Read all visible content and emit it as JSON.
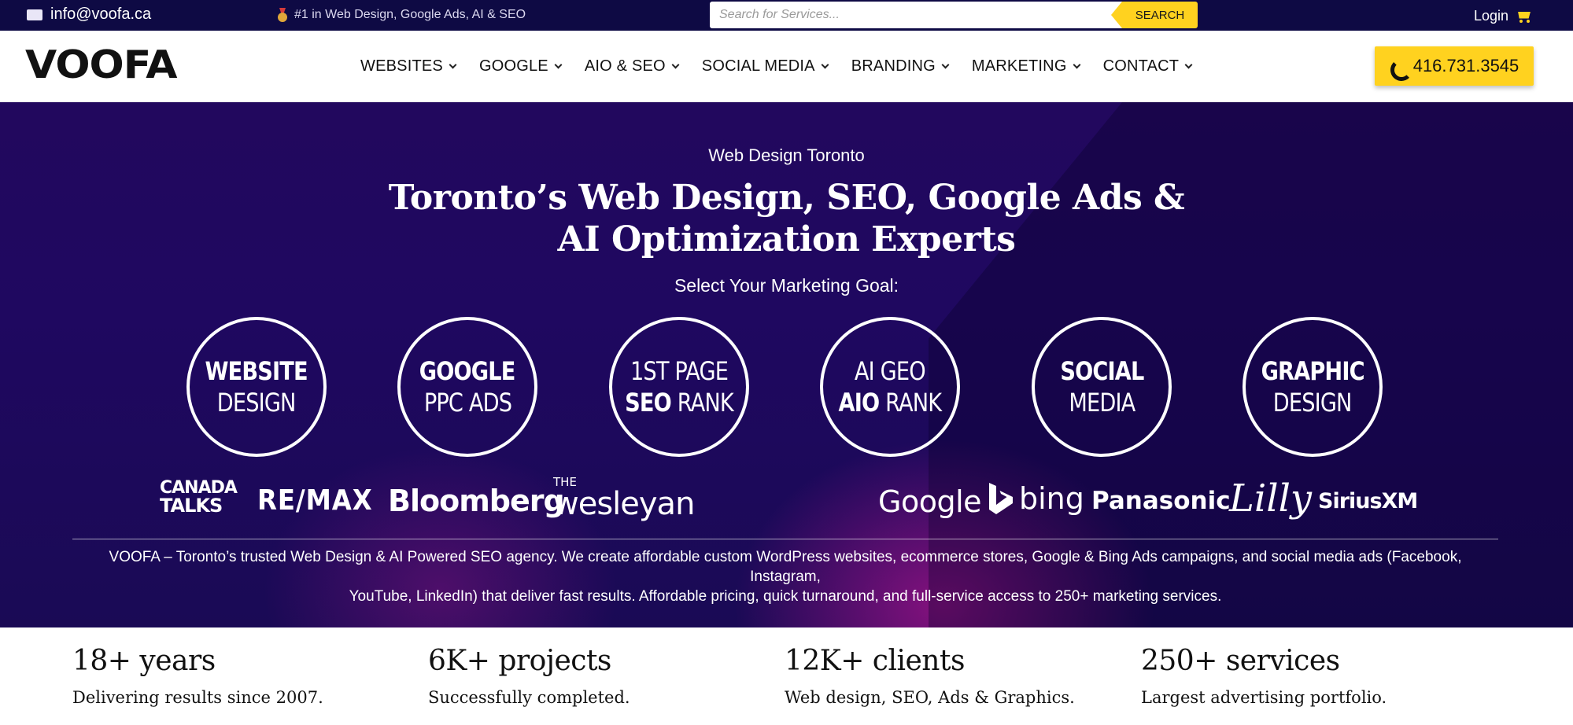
{
  "topbar": {
    "email": "info@voofa.ca",
    "tagline": "#1 in Web Design, Google Ads, AI & SEO",
    "search_placeholder": "Search for Services...",
    "search_button": "SEARCH",
    "login": "Login"
  },
  "header": {
    "logo": "VOOFA",
    "nav": [
      {
        "label": "WEBSITES"
      },
      {
        "label": "GOOGLE"
      },
      {
        "label": "AIO & SEO"
      },
      {
        "label": "SOCIAL MEDIA"
      },
      {
        "label": "BRANDING"
      },
      {
        "label": "MARKETING"
      },
      {
        "label": "CONTACT"
      }
    ],
    "phone": "416.731.3545"
  },
  "hero": {
    "subtitle": "Web Design Toronto",
    "title_line1": "Toronto’s Web Design, SEO, Google Ads &",
    "title_line2": "AI Optimization Experts",
    "goal_prompt": "Select Your Marketing Goal:",
    "goals": [
      {
        "line1": "WEBSITE",
        "line2": "DESIGN"
      },
      {
        "line1": "GOOGLE",
        "line2": "PPC ADS"
      },
      {
        "line1": "1ST PAGE",
        "line2a": "SEO",
        "line2b": "RANK"
      },
      {
        "line1": "AI GEO",
        "line2a": "AIO",
        "line2b": "RANK"
      },
      {
        "line1": "SOCIAL",
        "line2": "MEDIA"
      },
      {
        "line1": "GRAPHIC",
        "line2": "DESIGN"
      }
    ],
    "client_logos": {
      "canada_talks_1": "CANADA",
      "canada_talks_2": "TALKS",
      "remax": "RE/MAX",
      "bloomberg": "Bloomberg",
      "wesleyan_the": "THE",
      "wesleyan": "wesleyan",
      "google": "Google",
      "bing": "bing",
      "panasonic": "Panasonic",
      "lilly": "Lilly",
      "siriusxm": "SiriusXM"
    },
    "description_line1": "VOOFA – Toronto’s trusted Web Design & AI Powered SEO agency. We create affordable custom WordPress websites, ecommerce stores, Google & Bing Ads campaigns, and social media ads (Facebook, Instagram,",
    "description_line2": "YouTube, LinkedIn) that deliver fast results. Affordable pricing, quick turnaround, and full-service access to 250+ marketing services."
  },
  "stats": [
    {
      "title": "18+ years",
      "desc": "Delivering results since 2007."
    },
    {
      "title": "6K+ projects",
      "desc": "Successfully completed."
    },
    {
      "title": "12K+ clients",
      "desc": "Web design, SEO, Ads & Graphics."
    },
    {
      "title": "250+ services",
      "desc": "Largest advertising portfolio."
    }
  ],
  "colors": {
    "topbar_bg": "#0e0a44",
    "accent_yellow": "#ffd21f",
    "hero_bg": "#22085e",
    "hero_glow": "#aa148c"
  },
  "icons": {
    "email": "envelope-icon",
    "tagline": "medal-icon",
    "cart": "cart-icon",
    "phone": "phone-icon",
    "nav_dropdown": "chevron-down-icon"
  }
}
